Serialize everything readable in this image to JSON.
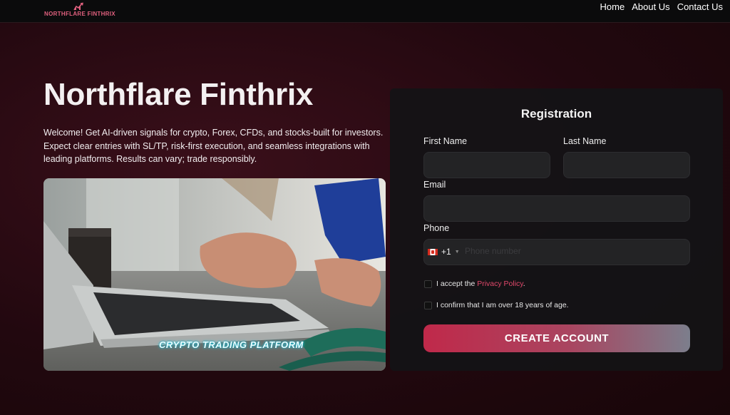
{
  "header": {
    "logo_text": "NORTHFLARE FINTHRIX",
    "nav": [
      {
        "label": "Home"
      },
      {
        "label": "About Us"
      },
      {
        "label": "Contact Us"
      }
    ]
  },
  "hero": {
    "title": "Northflare Finthrix",
    "description": "Welcome! Get AI-driven signals for crypto, Forex, CFDs, and stocks-built for investors. Expect clear entries with SL/TP, risk-first execution, and seamless integrations with leading platforms. Results can vary; trade responsibly.",
    "image_caption": "CRYPTO TRADING PLATFORM"
  },
  "registration": {
    "title": "Registration",
    "first_name_label": "First Name",
    "first_name_value": "",
    "last_name_label": "Last Name",
    "last_name_value": "",
    "email_label": "Email",
    "email_value": "",
    "phone_label": "Phone",
    "phone_country_code": "+1",
    "phone_placeholder": "Phone number",
    "privacy_prefix": "I accept the ",
    "privacy_link": "Privacy Policy",
    "privacy_suffix": ".",
    "age_label": "I confirm that I am over 18 years of age.",
    "submit_label": "CREATE ACCOUNT"
  },
  "colors": {
    "accent": "#e0486a",
    "brand_pink": "#e0607e",
    "background": "#22080f",
    "card": "#141416"
  },
  "icons": {
    "logo": "flame-chart-logo-icon",
    "flag": "canada-flag-icon",
    "dropdown": "chevron-down-icon"
  }
}
